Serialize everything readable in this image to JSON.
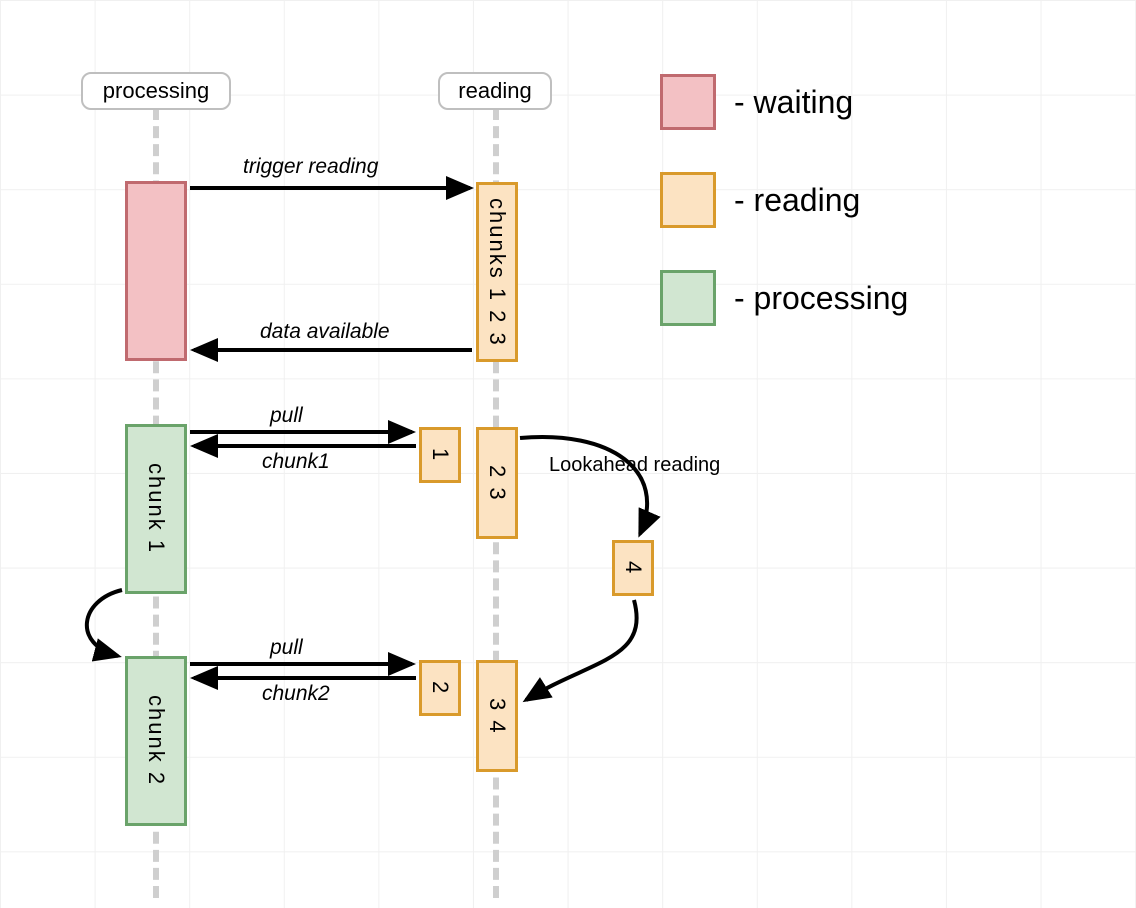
{
  "lanes": {
    "processing": {
      "label": "processing"
    },
    "reading": {
      "label": "reading"
    }
  },
  "messages": {
    "trigger_reading": "trigger reading",
    "data_available": "data available",
    "pull1": "pull",
    "chunk1_return": "chunk1",
    "pull2": "pull",
    "chunk2_return": "chunk2",
    "lookahead": "Lookahead reading"
  },
  "blocks": {
    "waiting": "",
    "chunks123": "chunks 1 2 3",
    "buf1": "1",
    "buf23": "2 3",
    "buf4": "4",
    "buf2": "2",
    "buf34": "3 4",
    "proc_chunk1": "chunk 1",
    "proc_chunk2": "chunk 2"
  },
  "legend": {
    "waiting": "- waiting",
    "reading": "- reading",
    "processing": "- processing"
  },
  "colors": {
    "waiting_fill": "#f3c1c4",
    "waiting_border": "#c06a6f",
    "reading_fill": "#fce3c2",
    "reading_border": "#d99a2b",
    "processing_fill": "#d1e6d1",
    "processing_border": "#6aa36a"
  }
}
